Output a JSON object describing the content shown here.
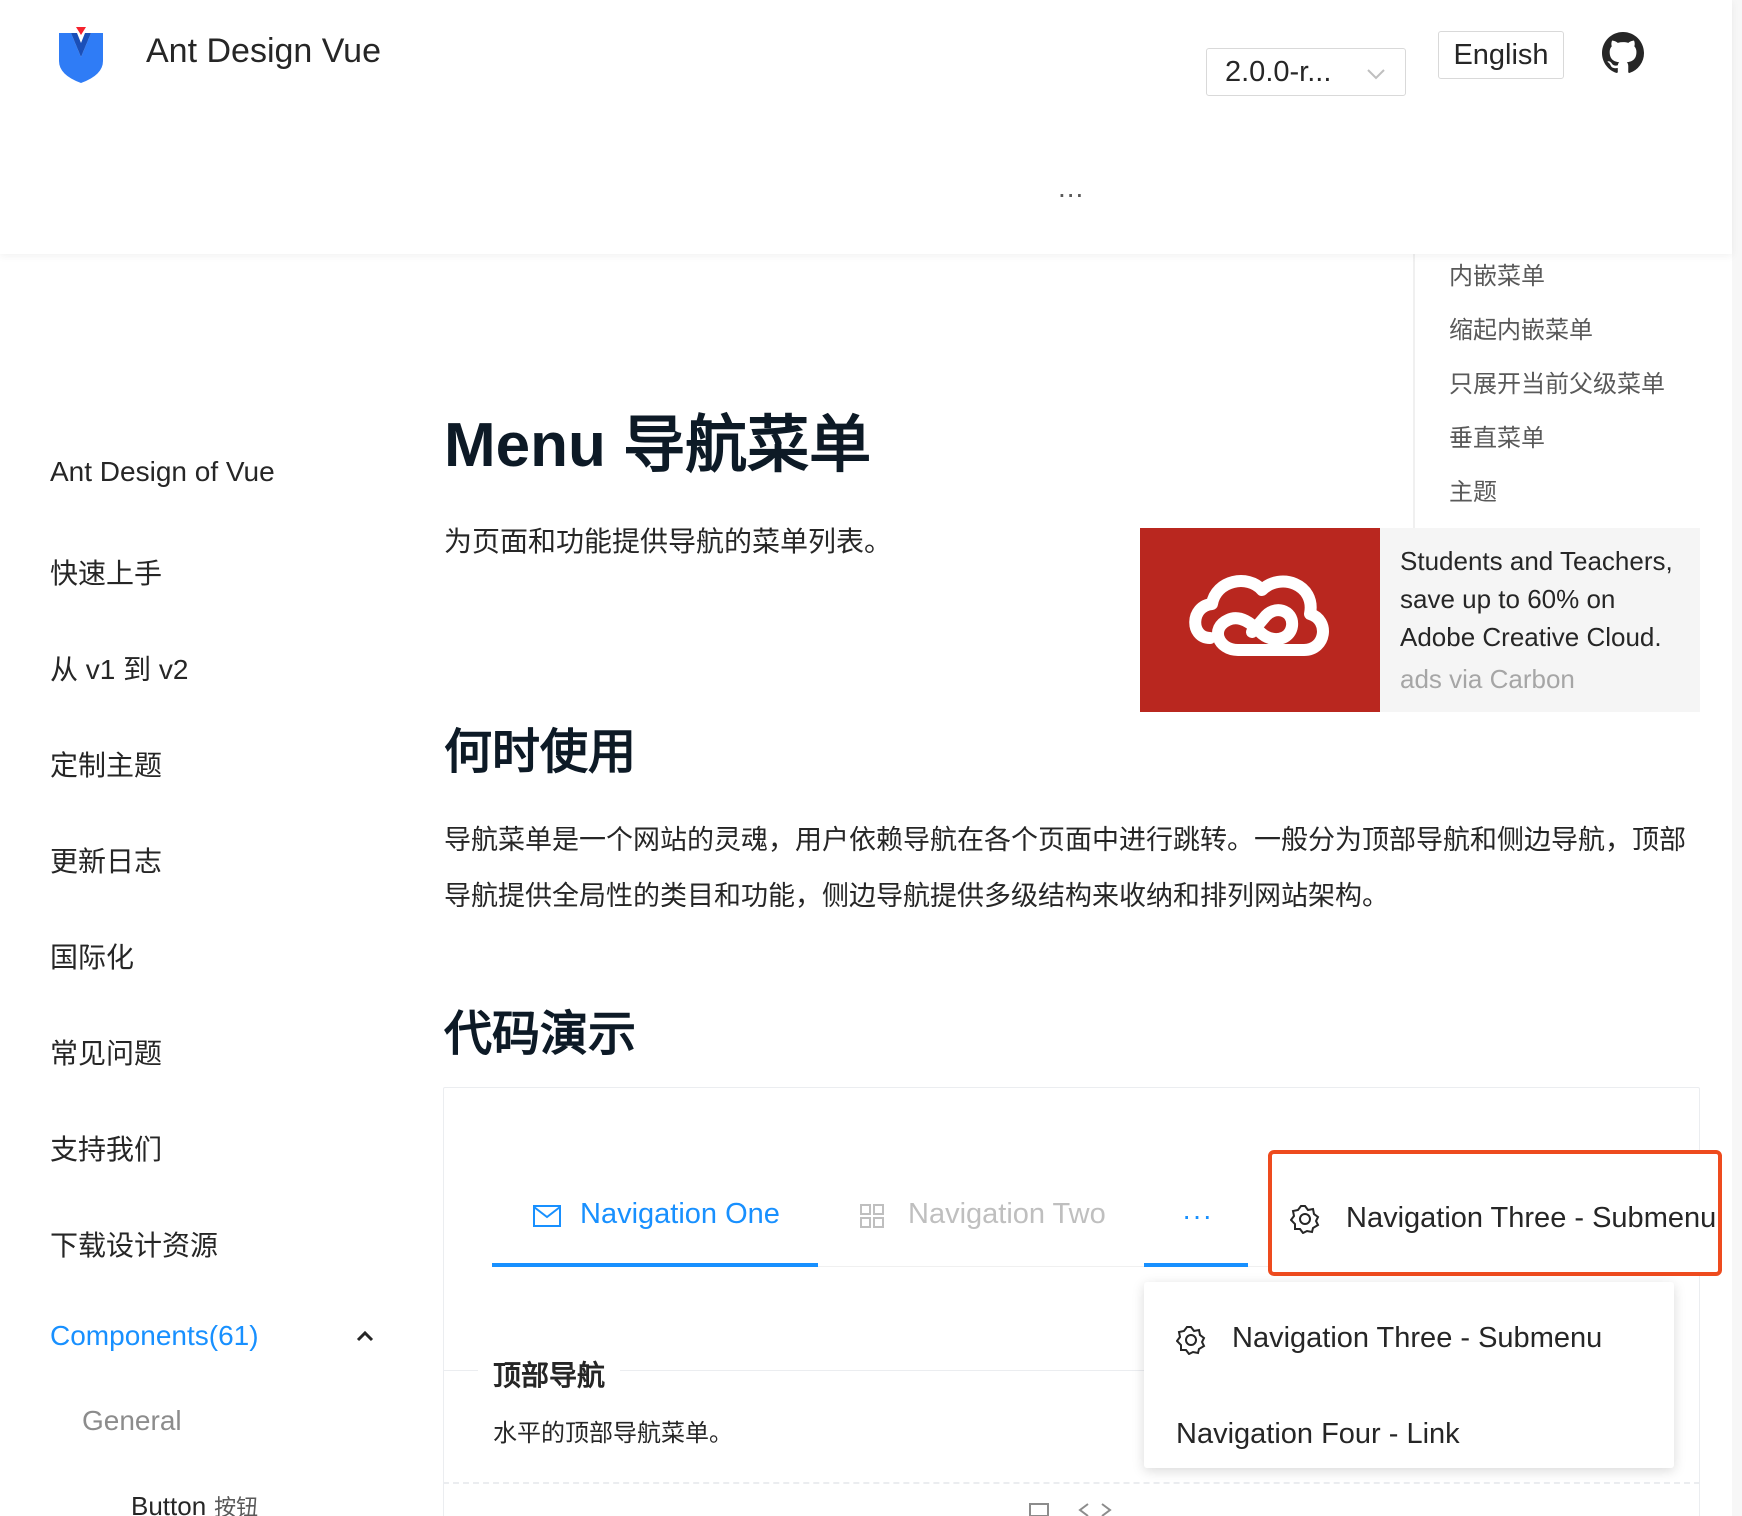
{
  "header": {
    "brand": "Ant Design Vue",
    "version": "2.0.0-r...",
    "language_button": "English",
    "more": "..."
  },
  "sidebar": {
    "items": [
      {
        "label": "Ant Design of Vue"
      },
      {
        "label": "快速上手"
      },
      {
        "label": "从 v1 到 v2"
      },
      {
        "label": "定制主题"
      },
      {
        "label": "更新日志"
      },
      {
        "label": "国际化"
      },
      {
        "label": "常见问题"
      },
      {
        "label": "支持我们"
      },
      {
        "label": "下载设计资源"
      }
    ],
    "components": "Components(61)",
    "group": "General",
    "sub_item": "Button",
    "sub_item_cn": "按钮"
  },
  "anchor": {
    "items": [
      "内嵌菜单",
      "缩起内嵌菜单",
      "只展开当前父级菜单",
      "垂直菜单",
      "主题"
    ]
  },
  "ad": {
    "text": "Students and Teachers, save up to 60% on Adobe Creative Cloud.",
    "via": "ads via Carbon"
  },
  "main": {
    "title": "Menu 导航菜单",
    "description": "为页面和功能提供导航的菜单列表。",
    "when_to_use": "何时使用",
    "when_paragraph": "导航菜单是一个网站的灵魂，用户依赖导航在各个页面中进行跳转。一般分为顶部导航和侧边导航，顶部导航提供全局性的类目和功能，侧边导航提供多级结构来收纳和排列网站架构。",
    "demo_heading": "代码演示"
  },
  "demo": {
    "menu": {
      "nav_one": "Navigation One",
      "nav_two": "Navigation Two",
      "ellipsis": "···",
      "nav_three": "Navigation Three - Submenu"
    },
    "dropdown": {
      "item1": "Navigation Three - Submenu",
      "item2": "Navigation Four - Link"
    },
    "title": "顶部导航",
    "description": "水平的顶部导航菜单。"
  },
  "colors": {
    "primary": "#1890ff",
    "highlight": "#ee4b1e",
    "ad_red": "#b9271f"
  }
}
